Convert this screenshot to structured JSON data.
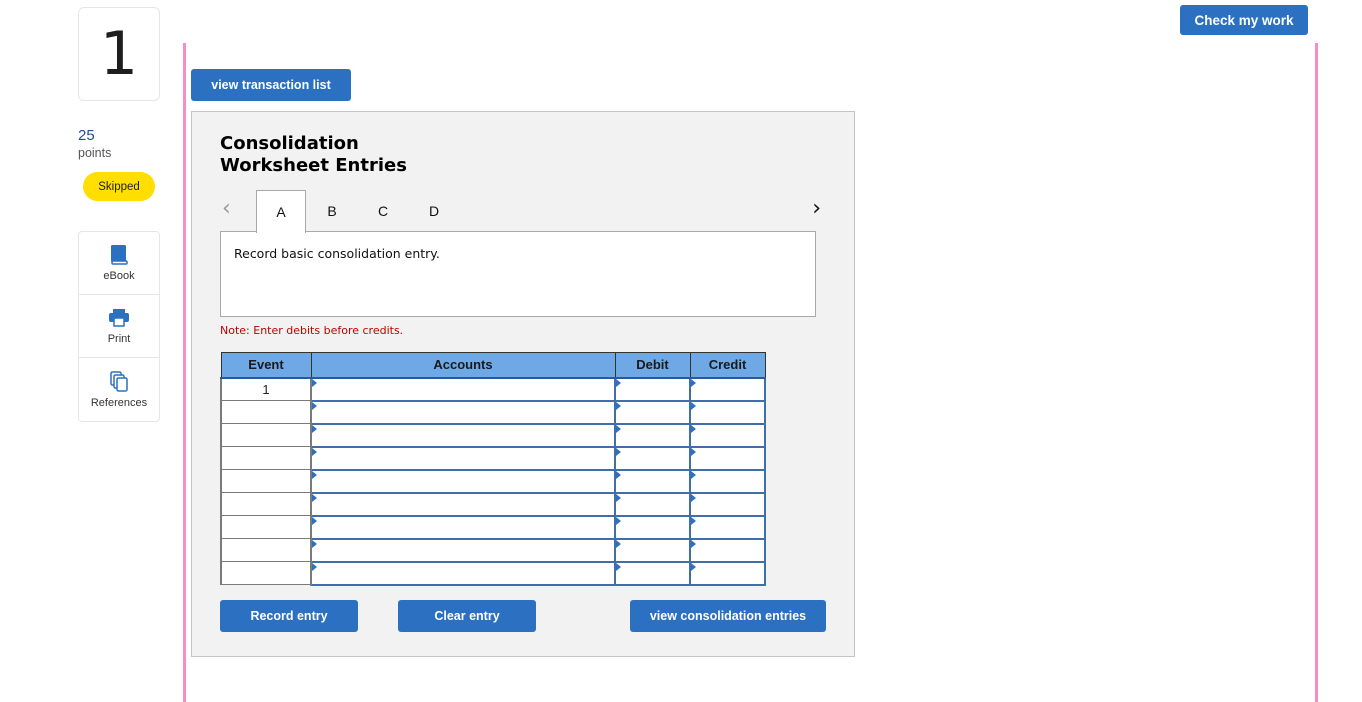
{
  "question": {
    "number": "1",
    "points_value": "25",
    "points_label": "points",
    "status_badge": "Skipped"
  },
  "tools": [
    {
      "label": "eBook",
      "icon": "book-icon"
    },
    {
      "label": "Print",
      "icon": "printer-icon"
    },
    {
      "label": "References",
      "icon": "copy-icon"
    }
  ],
  "header": {
    "check_my_work": "Check my work",
    "view_transaction_list": "view transaction list"
  },
  "worksheet": {
    "title_line1": "Consolidation",
    "title_line2": "Worksheet Entries",
    "prev_arrow": "‹",
    "next_arrow": "›",
    "tabs": [
      {
        "label": "A",
        "active": true
      },
      {
        "label": "B",
        "active": false
      },
      {
        "label": "C",
        "active": false
      },
      {
        "label": "D",
        "active": false
      }
    ],
    "description": "Record basic consolidation entry.",
    "note": "Note: Enter debits before credits.",
    "table": {
      "headers": [
        "Event",
        "Accounts",
        "Debit",
        "Credit"
      ],
      "rows": [
        {
          "event": "1",
          "account": "",
          "debit": "",
          "credit": ""
        },
        {
          "event": "",
          "account": "",
          "debit": "",
          "credit": ""
        },
        {
          "event": "",
          "account": "",
          "debit": "",
          "credit": ""
        },
        {
          "event": "",
          "account": "",
          "debit": "",
          "credit": ""
        },
        {
          "event": "",
          "account": "",
          "debit": "",
          "credit": ""
        },
        {
          "event": "",
          "account": "",
          "debit": "",
          "credit": ""
        },
        {
          "event": "",
          "account": "",
          "debit": "",
          "credit": ""
        },
        {
          "event": "",
          "account": "",
          "debit": "",
          "credit": ""
        },
        {
          "event": "",
          "account": "",
          "debit": "",
          "credit": ""
        }
      ]
    },
    "buttons": {
      "record_entry": "Record entry",
      "clear_entry": "Clear entry",
      "view_consolidation_entries": "view consolidation entries"
    }
  },
  "colors": {
    "primary_button": "#2c70c2",
    "table_header": "#6ea9e6",
    "badge_yellow": "#ffde00",
    "note_red": "#c00000",
    "pink_rule": "#f78cc7",
    "points_blue": "#1d4f91"
  }
}
